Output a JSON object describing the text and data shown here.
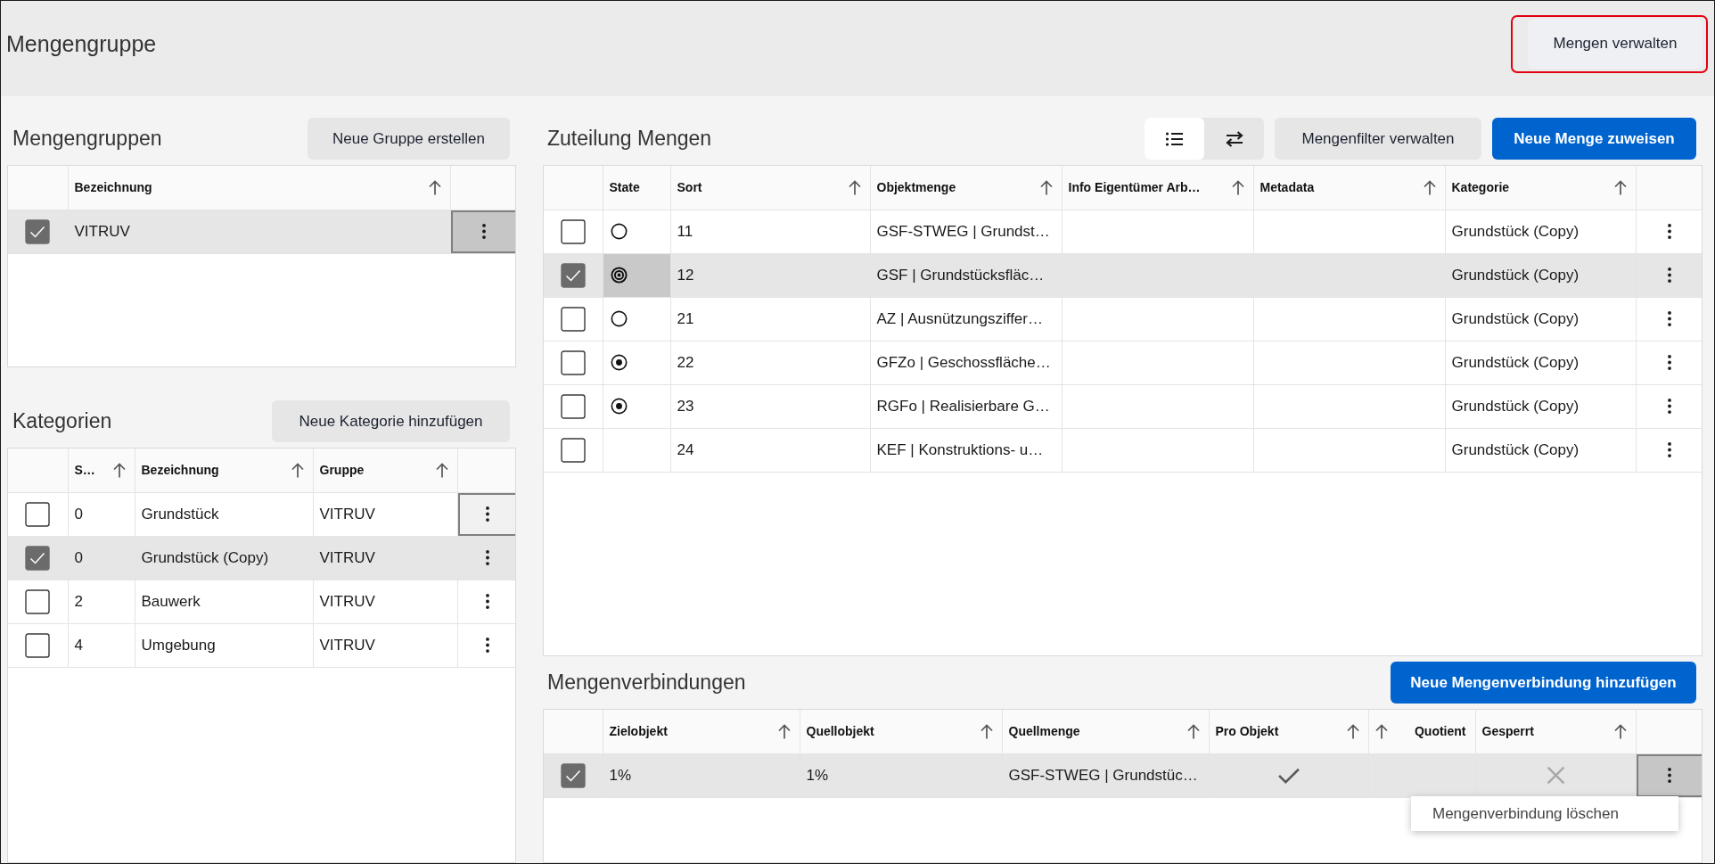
{
  "header": {
    "title": "Mengengruppe",
    "manage_button": {
      "label": "Mengen verwalten",
      "highlighted": true
    }
  },
  "groups": {
    "title": "Mengengruppen",
    "button": "Neue Gruppe erstellen",
    "columns": [
      {
        "label": "Bezeichnung",
        "sortable": true
      }
    ],
    "rows": [
      {
        "selected": true,
        "bezeichnung": "VITRUV",
        "menu_pressed": true,
        "menu_focused": true
      }
    ]
  },
  "categories": {
    "title": "Kategorien",
    "button": "Neue Kategorie hinzufügen",
    "columns": [
      {
        "label": "S…",
        "sortable": true
      },
      {
        "label": "Bezeichnung",
        "sortable": true
      },
      {
        "label": "Gruppe",
        "sortable": true
      }
    ],
    "rows": [
      {
        "selected": false,
        "column_1": "0",
        "bezeichnung": "Grundstück",
        "gruppe": "VITRUV",
        "menu_pressed": false,
        "menu_focused": true
      },
      {
        "selected": true,
        "column_1": "0",
        "bezeichnung": "Grundstück (Copy)",
        "gruppe": "VITRUV",
        "menu_pressed": false,
        "menu_focused": false
      },
      {
        "selected": false,
        "column_1": "2",
        "bezeichnung": "Bauwerk",
        "gruppe": "VITRUV",
        "menu_pressed": false,
        "menu_focused": false
      },
      {
        "selected": false,
        "column_1": "4",
        "bezeichnung": "Umgebung",
        "gruppe": "VITRUV",
        "menu_pressed": false,
        "menu_focused": false
      }
    ]
  },
  "assignments": {
    "title": "Zuteilung Mengen",
    "view_toggle": [
      {
        "selected": true
      },
      {
        "selected": false
      }
    ],
    "filter_button": "Mengenfilter verwalten",
    "primary_button": "Neue Menge zuweisen",
    "columns": [
      {
        "label": "State",
        "sortable": false
      },
      {
        "label": "Sort",
        "sortable": true
      },
      {
        "label": "Objektmenge",
        "sortable": true
      },
      {
        "label": "Info Eigentümer Arb…",
        "sortable": true
      },
      {
        "label": "Metadata",
        "sortable": true
      },
      {
        "label": "Kategorie",
        "sortable": true
      }
    ],
    "rows": [
      {
        "selected": false,
        "state": {
          "kind": "empty",
          "focused": false
        },
        "sort": "11",
        "objektmenge": "GSF-STWEG | Grundst…",
        "kategorie": "Grundstück (Copy)",
        "menu_pressed": false,
        "menu_focused": false
      },
      {
        "selected": true,
        "state": {
          "kind": "target",
          "focused": true
        },
        "sort": "12",
        "objektmenge": "GSF | Grundstücksfläc…",
        "kategorie": "Grundstück (Copy)",
        "menu_pressed": false,
        "menu_focused": false
      },
      {
        "selected": false,
        "state": {
          "kind": "empty",
          "focused": false
        },
        "sort": "21",
        "objektmenge": "AZ | Ausnützungsziffer…",
        "kategorie": "Grundstück (Copy)",
        "menu_pressed": false,
        "menu_focused": false
      },
      {
        "selected": false,
        "state": {
          "kind": "dot",
          "focused": false
        },
        "sort": "22",
        "objektmenge": "GFZo | Geschossfläche…",
        "kategorie": "Grundstück (Copy)",
        "menu_pressed": false,
        "menu_focused": false
      },
      {
        "selected": false,
        "state": {
          "kind": "dot",
          "focused": false
        },
        "sort": "23",
        "objektmenge": "RGFo | Realisierbare G…",
        "kategorie": "Grundstück (Copy)",
        "menu_pressed": false,
        "menu_focused": false
      },
      {
        "selected": false,
        "state": {
          "kind": "none",
          "focused": false
        },
        "sort": "24",
        "objektmenge": "KEF | Konstruktions- u…",
        "kategorie": "Grundstück (Copy)",
        "menu_pressed": false,
        "menu_focused": false
      }
    ]
  },
  "connections": {
    "title": "Mengenverbindungen",
    "button": "Neue Mengenverbindung hinzufügen",
    "columns": [
      {
        "label": "Zielobjekt",
        "sortable": true,
        "numeric": false
      },
      {
        "label": "Quellobjekt",
        "sortable": true,
        "numeric": false
      },
      {
        "label": "Quellmenge",
        "sortable": true,
        "numeric": false
      },
      {
        "label": "Pro Objekt",
        "sortable": true,
        "numeric": false
      },
      {
        "label": "Quotient",
        "sortable": true,
        "numeric": true
      },
      {
        "label": "Gesperrt",
        "sortable": true,
        "numeric": false
      }
    ],
    "rows": [
      {
        "selected": true,
        "zielobjekt": "1%",
        "quellobjekt": "1%",
        "quellmenge": "GSF-STWEG | Grundstüc…",
        "pro_objekt": true,
        "gesperrt": false,
        "menu_pressed": true,
        "menu_focused": true
      }
    ],
    "context_menu": [
      "Mengenverbindung löschen"
    ]
  }
}
